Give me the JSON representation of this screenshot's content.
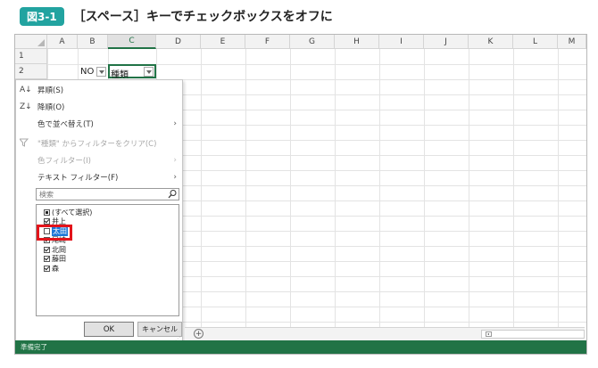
{
  "figure": {
    "badge": "図3-1",
    "title": "［スペース］キーでチェックボックスをオフに"
  },
  "sheet": {
    "columns": [
      "A",
      "B",
      "C",
      "D",
      "E",
      "F",
      "G",
      "H",
      "I",
      "J",
      "K",
      "L",
      "M"
    ],
    "active_column": "C",
    "rows": [
      "1",
      "2"
    ],
    "cells": {
      "b2": "NO",
      "c2": "種類"
    }
  },
  "filter_menu": {
    "sort_asc": "昇順(S)",
    "sort_desc": "降順(O)",
    "sort_by_color": "色で並べ替え(T)",
    "clear_filter": "\"種類\" からフィルターをクリア(C)",
    "color_filter": "色フィルター(I)",
    "text_filter": "テキスト フィルター(F)",
    "search_placeholder": "検索",
    "items": [
      {
        "label": "(すべて選択)",
        "state": "partial"
      },
      {
        "label": "井上",
        "state": "checked"
      },
      {
        "label": "太田",
        "state": "unchecked",
        "selected": true
      },
      {
        "label": "尾崎",
        "state": "checked"
      },
      {
        "label": "北岡",
        "state": "checked"
      },
      {
        "label": "藤田",
        "state": "checked"
      },
      {
        "label": "森",
        "state": "checked"
      }
    ],
    "ok": "OK",
    "cancel": "キャンセル"
  },
  "sheet_tabs": {
    "add_symbol": "+"
  },
  "status": {
    "text": "準備完了"
  },
  "colors": {
    "accent": "#217346",
    "badge": "#22a3a0",
    "highlight": "#e3141b",
    "selection": "#1e78d7"
  }
}
